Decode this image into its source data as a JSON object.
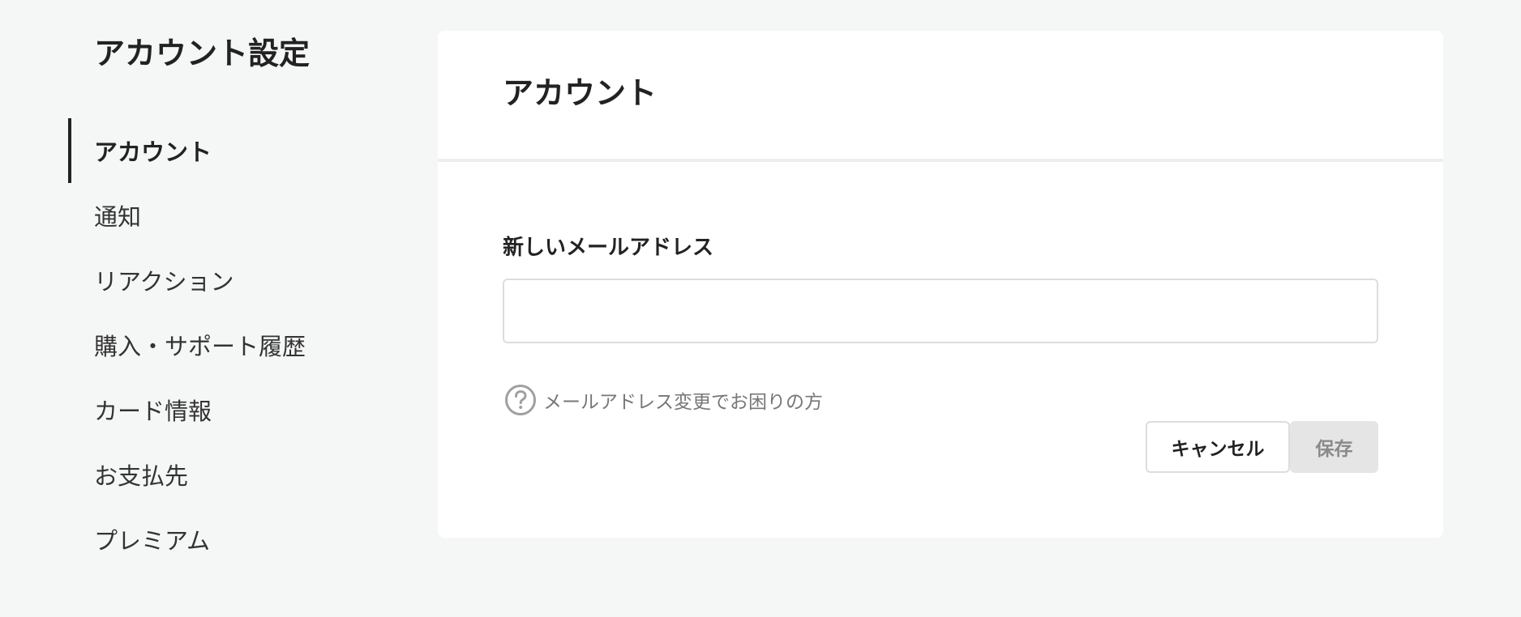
{
  "sidebar": {
    "title": "アカウント設定",
    "items": [
      {
        "label": "アカウント",
        "active": true
      },
      {
        "label": "通知",
        "active": false
      },
      {
        "label": "リアクション",
        "active": false
      },
      {
        "label": "購入・サポート履歴",
        "active": false
      },
      {
        "label": "カード情報",
        "active": false
      },
      {
        "label": "お支払先",
        "active": false
      },
      {
        "label": "プレミアム",
        "active": false
      }
    ]
  },
  "main": {
    "title": "アカウント",
    "email_field": {
      "label": "新しいメールアドレス",
      "value": "",
      "placeholder": ""
    },
    "help": {
      "icon": "question-circle-icon",
      "text": "メールアドレス変更でお困りの方"
    },
    "buttons": {
      "cancel_label": "キャンセル",
      "save_label": "保存",
      "save_disabled": true
    }
  },
  "colors": {
    "page_background": "#f5f7f6",
    "panel_background": "#ffffff",
    "text_primary": "#222222",
    "text_muted": "#777777",
    "active_indicator": "#222222",
    "disabled_button": "#e5e5e5"
  }
}
